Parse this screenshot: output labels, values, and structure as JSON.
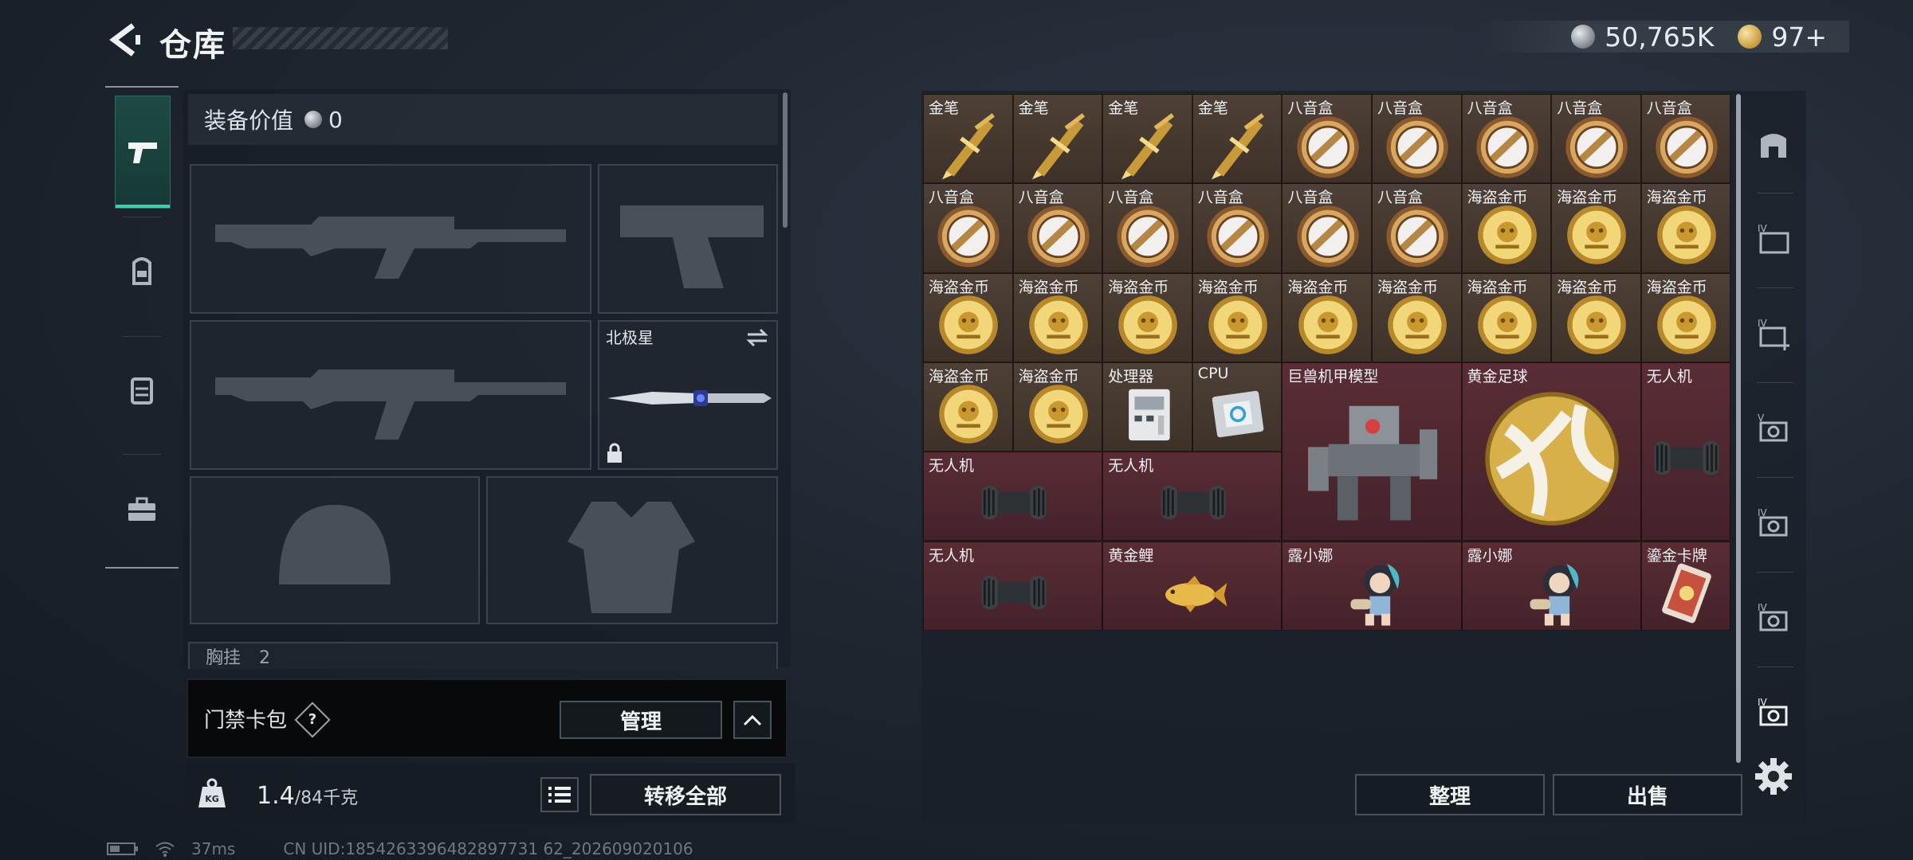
{
  "header": {
    "title": "仓库",
    "silver_amount": "50,765K",
    "gold_amount": "97+"
  },
  "equipment": {
    "value_label": "装备价值",
    "value": "0",
    "melee_slot_label": "北极星",
    "chest_label": "胸挂",
    "chest_extra": "2"
  },
  "card_pack": {
    "label": "门禁卡包",
    "help": "?",
    "manage_label": "管理"
  },
  "weight": {
    "current": "1.4",
    "max": "/84千克",
    "kg_icon_text": "KG"
  },
  "transfer_all_label": "转移全部",
  "status": {
    "ping": "37ms",
    "uid": "CN UID:1854263396482897731 62_202609020106"
  },
  "stash": {
    "sort_label": "整理",
    "sell_label": "出售",
    "items": [
      {
        "name": "金笔",
        "icon": "gold-pen-icon",
        "bg": "brown"
      },
      {
        "name": "金笔",
        "icon": "gold-pen-icon",
        "bg": "brown"
      },
      {
        "name": "金笔",
        "icon": "gold-pen-icon",
        "bg": "brown"
      },
      {
        "name": "金笔",
        "icon": "gold-pen-icon",
        "bg": "brown"
      },
      {
        "name": "八音盒",
        "icon": "music-box-icon",
        "bg": "brown"
      },
      {
        "name": "八音盒",
        "icon": "music-box-icon",
        "bg": "brown"
      },
      {
        "name": "八音盒",
        "icon": "music-box-icon",
        "bg": "brown"
      },
      {
        "name": "八音盒",
        "icon": "music-box-icon",
        "bg": "brown"
      },
      {
        "name": "八音盒",
        "icon": "music-box-icon",
        "bg": "brown"
      },
      {
        "name": "八音盒",
        "icon": "music-box-icon",
        "bg": "brown"
      },
      {
        "name": "八音盒",
        "icon": "music-box-icon",
        "bg": "brown"
      },
      {
        "name": "八音盒",
        "icon": "music-box-icon",
        "bg": "brown"
      },
      {
        "name": "八音盒",
        "icon": "music-box-icon",
        "bg": "brown"
      },
      {
        "name": "八音盒",
        "icon": "music-box-icon",
        "bg": "brown"
      },
      {
        "name": "八音盒",
        "icon": "music-box-icon",
        "bg": "brown"
      },
      {
        "name": "海盗金币",
        "icon": "pirate-coin-icon",
        "bg": "brown"
      },
      {
        "name": "海盗金币",
        "icon": "pirate-coin-icon",
        "bg": "brown"
      },
      {
        "name": "海盗金币",
        "icon": "pirate-coin-icon",
        "bg": "brown"
      },
      {
        "name": "海盗金币",
        "icon": "pirate-coin-icon",
        "bg": "brown"
      },
      {
        "name": "海盗金币",
        "icon": "pirate-coin-icon",
        "bg": "brown"
      },
      {
        "name": "海盗金币",
        "icon": "pirate-coin-icon",
        "bg": "brown"
      },
      {
        "name": "海盗金币",
        "icon": "pirate-coin-icon",
        "bg": "brown"
      },
      {
        "name": "海盗金币",
        "icon": "pirate-coin-icon",
        "bg": "brown"
      },
      {
        "name": "海盗金币",
        "icon": "pirate-coin-icon",
        "bg": "brown"
      },
      {
        "name": "海盗金币",
        "icon": "pirate-coin-icon",
        "bg": "brown"
      },
      {
        "name": "海盗金币",
        "icon": "pirate-coin-icon",
        "bg": "brown"
      },
      {
        "name": "海盗金币",
        "icon": "pirate-coin-icon",
        "bg": "brown"
      },
      {
        "name": "海盗金币",
        "icon": "pirate-coin-icon",
        "bg": "brown"
      },
      {
        "name": "海盗金币",
        "icon": "pirate-coin-icon",
        "bg": "brown"
      },
      {
        "name": "处理器",
        "icon": "processor-icon",
        "bg": "brown"
      },
      {
        "name": "CPU",
        "icon": "cpu-icon",
        "bg": "brown"
      },
      {
        "name": "巨兽机甲模型",
        "icon": "mech-model-icon",
        "bg": "red"
      },
      {
        "name": "黄金足球",
        "icon": "golden-football-icon",
        "bg": "red"
      },
      {
        "name": "无人机",
        "icon": "drone-icon",
        "bg": "red"
      },
      {
        "name": "无人机",
        "icon": "drone-icon",
        "bg": "red"
      },
      {
        "name": "无人机",
        "icon": "drone-icon",
        "bg": "red"
      },
      {
        "name": "无人机",
        "icon": "drone-icon",
        "bg": "red"
      },
      {
        "name": "黄金鲤",
        "icon": "golden-carp-icon",
        "bg": "red"
      },
      {
        "name": "露小娜",
        "icon": "luna-doll-icon",
        "bg": "red"
      },
      {
        "name": "露小娜",
        "icon": "luna-doll-icon",
        "bg": "red"
      },
      {
        "name": "鎏金卡牌",
        "icon": "gilded-card-icon",
        "bg": "red"
      }
    ]
  },
  "right_tabs": [
    {
      "icon": "all-items-icon"
    },
    {
      "icon": "folder-iv-icon"
    },
    {
      "icon": "add-folder-iv-icon"
    },
    {
      "icon": "stash-v-icon"
    },
    {
      "icon": "stash-iv-a-icon"
    },
    {
      "icon": "stash-iv-b-icon"
    },
    {
      "icon": "stash-iv-c-icon"
    }
  ]
}
